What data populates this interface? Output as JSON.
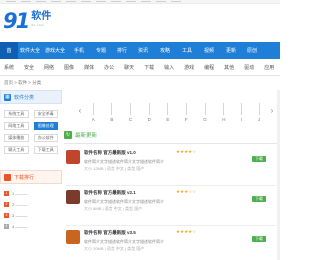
{
  "logo": {
    "mark": "9",
    "mark2": "1",
    "name": "软件",
    "sub": "91.com"
  },
  "nav": {
    "items": [
      "首",
      "软件大全",
      "游戏大全",
      "手机",
      "专题",
      "排行",
      "资讯",
      "攻略",
      "工具",
      "视频",
      "更新",
      "原创"
    ],
    "active_index": 0
  },
  "subnav": {
    "items": [
      "系统",
      "安全",
      "网络",
      "图像",
      "媒体",
      "办公",
      "聊天",
      "下载",
      "输入",
      "游戏",
      "编程",
      "其他",
      "驱动",
      "应用"
    ]
  },
  "breadcrumb": "首页 > 软件 > 分类",
  "sidebar": {
    "category_title": "软件分类",
    "tags": [
      "系统工具",
      "安全杀毒",
      "网络工具",
      "图像处理",
      "媒体播放",
      "办公软件",
      "聊天工具",
      "下载工具"
    ],
    "active_tag_index": 3,
    "rank_title": "下载排行",
    "rank_items": [
      "1 ———",
      "2 ———",
      "3 ———",
      "4 ———"
    ]
  },
  "index_strip": {
    "prev": "‹",
    "next": "›",
    "letters": [
      "A",
      "B",
      "C",
      "D",
      "E",
      "F",
      "G",
      "H",
      "I",
      "J"
    ]
  },
  "section": {
    "title": "最新更新"
  },
  "apps": [
    {
      "title": "软件名称 官方最新版 v1.0",
      "stars": "★★★★☆",
      "desc": "软件简介文字描述软件简介文字描述软件简介",
      "meta": "大小 12MB | 语言 中文 | 类型 国产",
      "download": "下载",
      "color": "#c0462b"
    },
    {
      "title": "软件名称 官方最新版 v2.1",
      "stars": "★★★☆☆",
      "desc": "软件简介文字描述软件简介文字描述软件简介",
      "meta": "大小 8MB | 语言 中文 | 类型 国产",
      "download": "下载",
      "color": "#7a3b2a"
    },
    {
      "title": "软件名称 官方最新版 v3.5",
      "stars": "★★★★☆",
      "desc": "软件简介文字描述软件简介文字描述软件简介",
      "meta": "大小 20MB | 语言 中文 | 类型 国产",
      "download": "下载",
      "color": "#c9651f"
    }
  ]
}
